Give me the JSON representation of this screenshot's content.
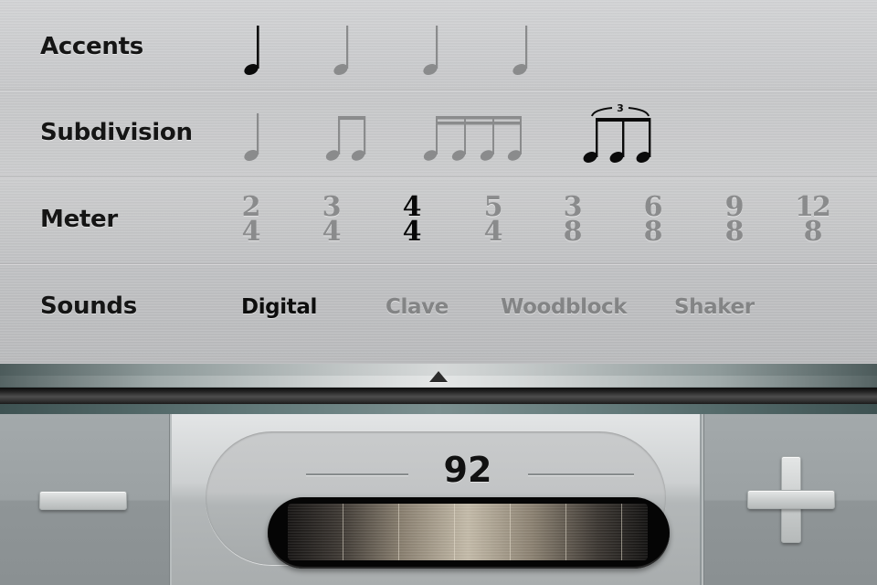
{
  "settings": {
    "rows": [
      {
        "label": "Accents"
      },
      {
        "label": "Subdivision"
      },
      {
        "label": "Meter"
      },
      {
        "label": "Sounds"
      }
    ],
    "accents": {
      "options": [
        {
          "icon": "quarter-note-icon",
          "selected": true
        },
        {
          "icon": "quarter-note-icon",
          "selected": false
        },
        {
          "icon": "quarter-note-icon",
          "selected": false
        },
        {
          "icon": "quarter-note-icon",
          "selected": false
        }
      ]
    },
    "subdivision": {
      "options": [
        {
          "icon": "quarter-note-icon",
          "selected": false
        },
        {
          "icon": "eighth-notes-icon",
          "selected": false
        },
        {
          "icon": "sixteenth-notes-icon",
          "selected": false
        },
        {
          "icon": "triplet-icon",
          "selected": true,
          "tuplet_label": "3"
        }
      ]
    },
    "meter": {
      "options": [
        {
          "top": "2",
          "bottom": "4",
          "selected": false
        },
        {
          "top": "3",
          "bottom": "4",
          "selected": false
        },
        {
          "top": "4",
          "bottom": "4",
          "selected": true
        },
        {
          "top": "5",
          "bottom": "4",
          "selected": false
        },
        {
          "top": "3",
          "bottom": "8",
          "selected": false
        },
        {
          "top": "6",
          "bottom": "8",
          "selected": false
        },
        {
          "top": "9",
          "bottom": "8",
          "selected": false
        },
        {
          "top": "12",
          "bottom": "8",
          "selected": false
        }
      ]
    },
    "sounds": {
      "options": [
        {
          "label": "Digital",
          "selected": true
        },
        {
          "label": "Clave",
          "selected": false
        },
        {
          "label": "Woodblock",
          "selected": false
        },
        {
          "label": "Shaker",
          "selected": false
        }
      ]
    }
  },
  "drawer": {
    "handle_icon": "up-arrow-icon"
  },
  "tempo": {
    "bpm": "92",
    "decrement_icon": "minus-icon",
    "increment_icon": "plus-icon"
  },
  "colors": {
    "selected_ink": "#0a0a0a",
    "unselected_ink": "#8a8b8c"
  }
}
